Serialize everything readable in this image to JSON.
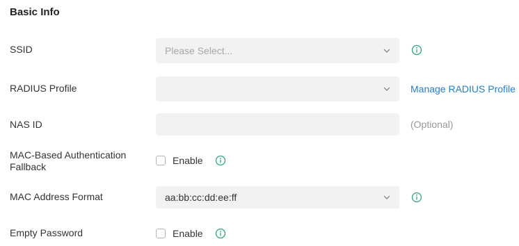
{
  "section": {
    "title": "Basic Info"
  },
  "ssid": {
    "label": "SSID",
    "placeholder": "Please Select..."
  },
  "radius_profile": {
    "label": "RADIUS Profile",
    "value": "",
    "link": "Manage RADIUS Profile"
  },
  "nas_id": {
    "label": "NAS ID",
    "value": "",
    "hint": "(Optional)"
  },
  "mac_auth_fallback": {
    "label": "MAC-Based Authentication Fallback",
    "checkbox_label": "Enable",
    "checked": false
  },
  "mac_address_format": {
    "label": "MAC Address Format",
    "value": "aa:bb:cc:dd:ee:ff"
  },
  "empty_password": {
    "label": "Empty Password",
    "checkbox_label": "Enable",
    "checked": false
  },
  "colors": {
    "info_icon": "#2aa876",
    "link": "#1f7fd4",
    "field_bg": "#f2f2f2"
  },
  "icons": [
    "info-icon",
    "chevron-down-icon"
  ]
}
